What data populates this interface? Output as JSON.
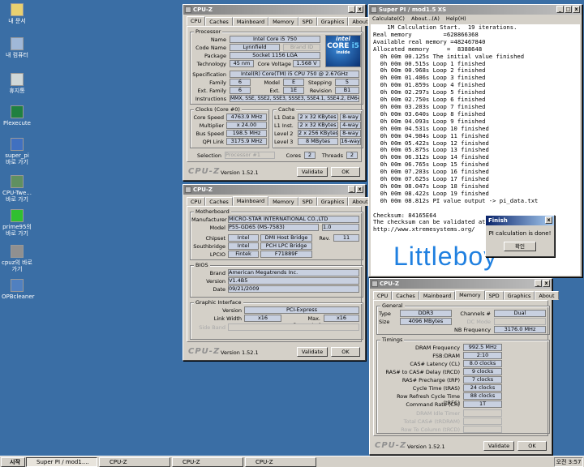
{
  "desktop": {
    "icons": [
      "내 문서",
      "내 컴퓨터",
      "휴지통",
      "Plexecute",
      "super_pi\n바로 가기",
      "CPU-Twe...\n바로 가기",
      "prime95의\n바로 가기",
      "cpuz의 바로\n가기",
      "OPBcleaner"
    ]
  },
  "cpuz": {
    "title": "CPU-Z",
    "logo": "CPU-Z",
    "version": "Version 1.52.1",
    "validate": "Validate",
    "ok": "OK",
    "tabs": [
      "CPU",
      "Caches",
      "Mainboard",
      "Memory",
      "SPD",
      "Graphics",
      "About"
    ]
  },
  "cpu": {
    "processor": "Processor",
    "name_l": "Name",
    "name": "Intel Core i5 750",
    "code_l": "Code Name",
    "code": "Lynnfield",
    "brand_l": "Brand ID",
    "pkg_l": "Package",
    "pkg": "Socket 1156 LGA",
    "tech_l": "Technology",
    "tech": "45 nm",
    "cv_l": "Core Voltage",
    "cv": "1.568 V",
    "spec_l": "Specification",
    "spec": "Intel(R) Core(TM) i5 CPU      750  @ 2.67GHz",
    "fam_l": "Family",
    "fam": "6",
    "model_l": "Model",
    "model": "E",
    "step_l": "Stepping",
    "step": "5",
    "efam_l": "Ext. Family",
    "efam": "6",
    "emod_l": "Ext. Model",
    "emod": "1E",
    "rev_l": "Revision",
    "rev": "B1",
    "instr_l": "Instructions",
    "instr": "MMX, SSE, SSE2, SSE3, SSSE3, SSE4.1, SSE4.2, EM64T",
    "clocks": "Clocks (Core #0)",
    "cs_l": "Core Speed",
    "cs": "4763.9 MHz",
    "mul_l": "Multiplier",
    "mul": "x 24.00",
    "bus_l": "Bus Speed",
    "bus": "198.5 MHz",
    "qpi_l": "QPI Link",
    "qpi": "3175.9 MHz",
    "cache": "Cache",
    "l1d_l": "L1 Data",
    "l1d": "2 x 32 KBytes",
    "l1d_w": "8-way",
    "l1i_l": "L1 Inst.",
    "l1i": "2 x 32 KBytes",
    "l1i_w": "4-way",
    "l2_l": "Level 2",
    "l2": "2 x 256 KBytes",
    "l2_w": "8-way",
    "l3_l": "Level 3",
    "l3": "8 MBytes",
    "l3_w": "16-way",
    "sel_l": "Selection",
    "sel": "Processor #1",
    "cores_l": "Cores",
    "cores": "2",
    "thr_l": "Threads",
    "thr": "2",
    "badge1": "intel",
    "badge2": "CORE",
    "badge3": "i5",
    "badge4": "inside"
  },
  "mb": {
    "mobo": "Motherboard",
    "man_l": "Manufacturer",
    "man": "MICRO-STAR INTERNATIONAL CO.,LTD",
    "model_l": "Model",
    "model": "P55-GD65 (MS-7583)",
    "model_r": "1.0",
    "chip_l": "Chipset",
    "chip_a": "Intel",
    "chip_b": "DMI Host Bridge",
    "chip_rl": "Rev.",
    "chip_r": "11",
    "sb_l": "Southbridge",
    "sb_a": "Intel",
    "sb_b": "PCH LPC Bridge",
    "lpcio_l": "LPCIO",
    "lpcio_a": "Fintek",
    "lpcio_b": "F71889F",
    "bios": "BIOS",
    "br_l": "Brand",
    "br": "American Megatrends Inc.",
    "bv_l": "Version",
    "bv": "V1.4B5",
    "bd_l": "Date",
    "bd": "09/21/2009",
    "gi": "Graphic Interface",
    "gv_l": "Version",
    "gv": "PCI-Express",
    "lw_l": "Link Width",
    "lw": "x16",
    "ms_l": "Max. Supported",
    "ms": "x16",
    "sb2_l": "Side Band"
  },
  "mem": {
    "gen": "General",
    "type_l": "Type",
    "type": "DDR3",
    "ch_l": "Channels #",
    "ch": "Dual",
    "size_l": "Size",
    "size": "4096 MBytes",
    "dc_l": "DC Mode",
    "nb_l": "NB Frequency",
    "nb": "3176.0 MHz",
    "timings": "Timings",
    "df_l": "DRAM Frequency",
    "df": "992.5 MHz",
    "fsb_l": "FSB:DRAM",
    "fsb": "2:10",
    "cl_l": "CAS# Latency (CL)",
    "cl": "8.0 clocks",
    "trcd_l": "RAS# to CAS# Delay (tRCD)",
    "trcd": "9 clocks",
    "trp_l": "RAS# Precharge (tRP)",
    "trp": "7 clocks",
    "tras_l": "Cycle Time (tRAS)",
    "tras": "24 clocks",
    "trfc_l": "Row Refresh Cycle Time (tRFC)",
    "trfc": "88 clocks",
    "cr_l": "Command Rate (CR)",
    "cr": "1T",
    "idle_l": "DRAM Idle Timer",
    "trdram_l": "Total CAS# (tRDRAM)",
    "trcd2_l": "Row To Column (tRCD)"
  },
  "superpi": {
    "title": "Super PI / mod1.5 XS",
    "menu": [
      "Calculate(C)",
      "About...(A)",
      "Help(H)"
    ],
    "lines": [
      "    1M Calculation Start.  19 iterations.",
      "Real memory         =628866368",
      "Available real memory =482467840",
      "Allocated memory     =  8388648",
      "  0h 00m 00.125s The initial value finished",
      "  0h 00m 00.515s Loop 1 finished",
      "  0h 00m 00.968s Loop 2 finished",
      "  0h 00m 01.406s Loop 3 finished",
      "  0h 00m 01.859s Loop 4 finished",
      "  0h 00m 02.297s Loop 5 finished",
      "  0h 00m 02.750s Loop 6 finished",
      "  0h 00m 03.203s Loop 7 finished",
      "  0h 00m 03.640s Loop 8 finished",
      "  0h 00m 04.093s Loop 9 finished",
      "  0h 00m 04.531s Loop 10 finished",
      "  0h 00m 04.984s Loop 11 finished",
      "  0h 00m 05.422s Loop 12 finished",
      "  0h 00m 05.875s Loop 13 finished",
      "  0h 00m 06.312s Loop 14 finished",
      "  0h 00m 06.765s Loop 15 finished",
      "  0h 00m 07.203s Loop 16 finished",
      "  0h 00m 07.625s Loop 17 finished",
      "  0h 00m 08.047s Loop 18 finished",
      "  0h 00m 08.422s Loop 19 finished",
      "  0h 00m 08.812s PI value output -> pi_data.txt",
      "",
      "Checksum: 84165E64",
      "The checksum can be validated at",
      "http://www.xtremesystems.org/"
    ],
    "watermark": "Littleboy"
  },
  "finish": {
    "title": "Finish",
    "msg": "PI calculation is done!",
    "ok": "확인"
  },
  "taskbar": {
    "start": "시작",
    "tasks": [
      "Super PI / mod1....",
      "CPU-Z",
      "CPU-Z",
      "CPU-Z"
    ],
    "clock": "오전 3:57"
  }
}
